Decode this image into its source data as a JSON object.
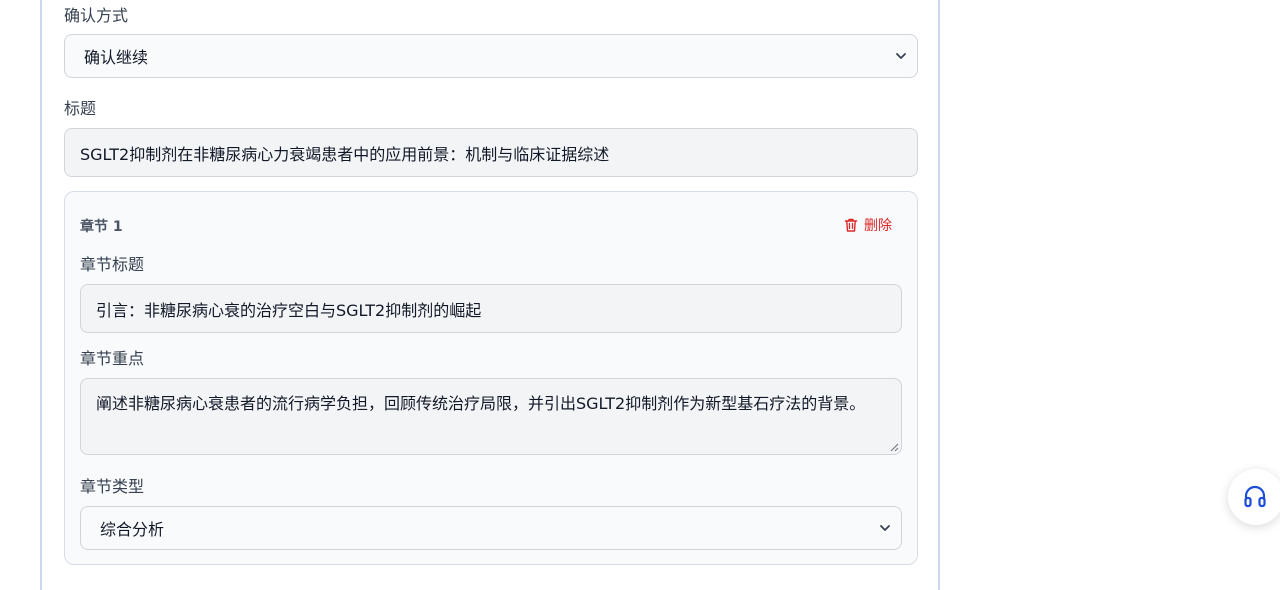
{
  "form": {
    "confirm_method_label": "确认方式",
    "confirm_method_value": "确认继续",
    "title_label": "标题",
    "title_value": "SGLT2抑制剂在非糖尿病心力衰竭患者中的应用前景：机制与临床证据综述"
  },
  "chapter": {
    "heading": "章节 1",
    "delete_label": "删除",
    "title_label": "章节标题",
    "title_value": "引言：非糖尿病心衰的治疗空白与SGLT2抑制剂的崛起",
    "focus_label": "章节重点",
    "focus_value": "阐述非糖尿病心衰患者的流行病学负担，回顾传统治疗局限，并引出SGLT2抑制剂作为新型基石疗法的背景。",
    "type_label": "章节类型",
    "type_value": "综合分析"
  },
  "icons": {
    "delete": "trash-icon",
    "dropdown": "chevron-down-icon",
    "support": "headset-icon"
  },
  "colors": {
    "accent": "#1d4ed8",
    "danger": "#dc2626",
    "panel_border": "#c9d8ec"
  }
}
